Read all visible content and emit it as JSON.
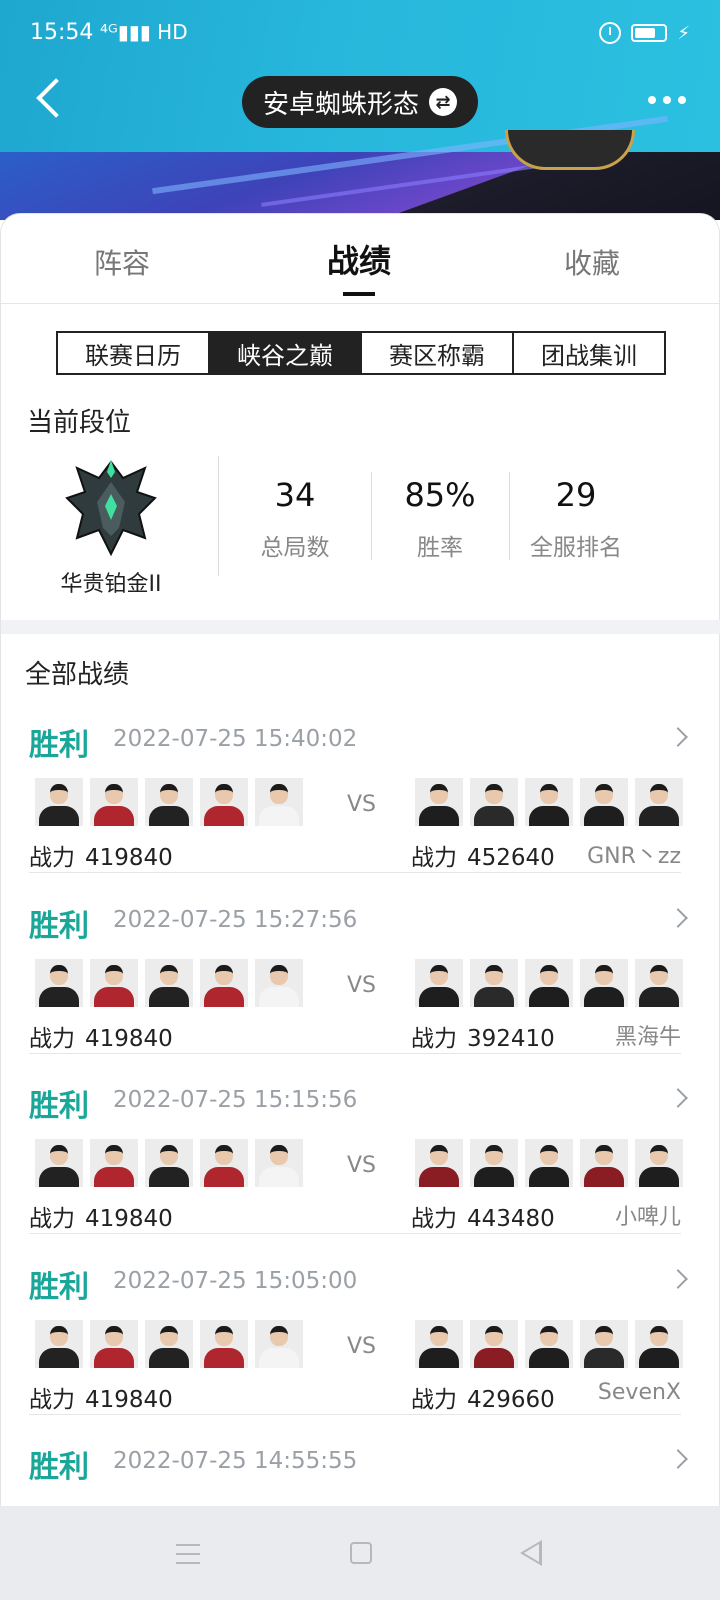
{
  "status": {
    "time": "15:54",
    "network": "⁴ᴳ▮▮▮ HD"
  },
  "header": {
    "title": "安卓蜘蛛形态",
    "swap_icon": "⇄"
  },
  "tabs": [
    "阵容",
    "战绩",
    "收藏"
  ],
  "segments": [
    "联赛日历",
    "峡谷之巅",
    "赛区称霸",
    "团战集训"
  ],
  "rank": {
    "section_title": "当前段位",
    "tier_name": "华贵铂金II",
    "stats": [
      {
        "value": "34",
        "label": "总局数"
      },
      {
        "value": "85%",
        "label": "胜率"
      },
      {
        "value": "29",
        "label": "全服排名"
      }
    ]
  },
  "records": {
    "section_title": "全部战绩",
    "power_label": "战力",
    "vs_label": "VS",
    "matches": [
      {
        "result": "胜利",
        "time": "2022-07-25 15:40:02",
        "my_power": "419840",
        "opp_power": "452640",
        "opp_name": "GNR丶zz"
      },
      {
        "result": "胜利",
        "time": "2022-07-25 15:27:56",
        "my_power": "419840",
        "opp_power": "392410",
        "opp_name": "黑海牛"
      },
      {
        "result": "胜利",
        "time": "2022-07-25 15:15:56",
        "my_power": "419840",
        "opp_power": "443480",
        "opp_name": "小啤儿"
      },
      {
        "result": "胜利",
        "time": "2022-07-25 15:05:00",
        "my_power": "419840",
        "opp_power": "429660",
        "opp_name": "SevenX"
      },
      {
        "result": "胜利",
        "time": "2022-07-25 14:55:55"
      }
    ]
  },
  "colors": {
    "win": "#1aa79a",
    "header": "#27b7dc"
  }
}
